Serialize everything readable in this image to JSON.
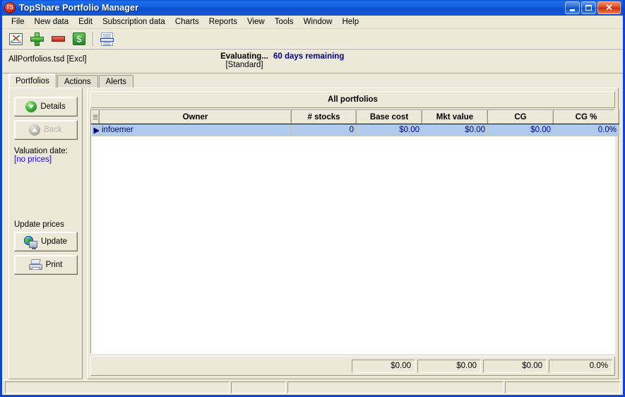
{
  "window": {
    "title": "TopShare Portfolio Manager",
    "app_icon": "ts-badge-icon",
    "minimize_label": "",
    "maximize_label": "",
    "close_label": "✕"
  },
  "menubar": {
    "items": [
      {
        "label": "File"
      },
      {
        "label": "New data"
      },
      {
        "label": "Edit"
      },
      {
        "label": "Subscription data"
      },
      {
        "label": "Charts"
      },
      {
        "label": "Reports"
      },
      {
        "label": "View"
      },
      {
        "label": "Tools"
      },
      {
        "label": "Window"
      },
      {
        "label": "Help"
      }
    ]
  },
  "toolbar": {
    "buttons": [
      {
        "name": "chart-icon",
        "tooltip": "Charts"
      },
      {
        "name": "add-icon",
        "tooltip": "Add"
      },
      {
        "name": "remove-icon",
        "tooltip": "Remove"
      },
      {
        "name": "dollar-icon",
        "tooltip": "Prices"
      },
      {
        "name": "report-icon",
        "tooltip": "Reports"
      }
    ]
  },
  "infostrip": {
    "file_name": "AllPortfolios.tsd [Excl]",
    "eval_status": "Evaluating...",
    "eval_edition": "[Standard]",
    "days_remaining": "60 days remaining",
    "days_color": "#00007e"
  },
  "tabs": [
    {
      "label": "Portfolios",
      "active": true
    },
    {
      "label": "Actions",
      "active": false
    },
    {
      "label": "Alerts",
      "active": false
    }
  ],
  "sidebar": {
    "details_button": "Details",
    "back_button": "Back",
    "valuation_label": "Valuation date:",
    "valuation_value": "[no prices]",
    "valuation_value_color": "#1500ff",
    "update_prices_label": "Update prices",
    "update_button": "Update",
    "print_button": "Print"
  },
  "grid": {
    "title": "All portfolios",
    "row_handle": "▶",
    "columns": [
      {
        "label": "Owner",
        "align": "left"
      },
      {
        "label": "# stocks",
        "align": "right"
      },
      {
        "label": "Base cost",
        "align": "right"
      },
      {
        "label": "Mkt value",
        "align": "right"
      },
      {
        "label": "CG",
        "align": "right"
      },
      {
        "label": "CG %",
        "align": "right"
      }
    ],
    "rows": [
      {
        "selected": true,
        "cells": [
          "infoemer",
          "0",
          "$0.00",
          "$0.00",
          "$0.00",
          "0.0%"
        ]
      }
    ],
    "totals": [
      "$0.00",
      "$0.00",
      "$0.00",
      "0.0%"
    ]
  },
  "statusbar": {
    "panels": [
      "",
      "",
      "",
      ""
    ]
  }
}
